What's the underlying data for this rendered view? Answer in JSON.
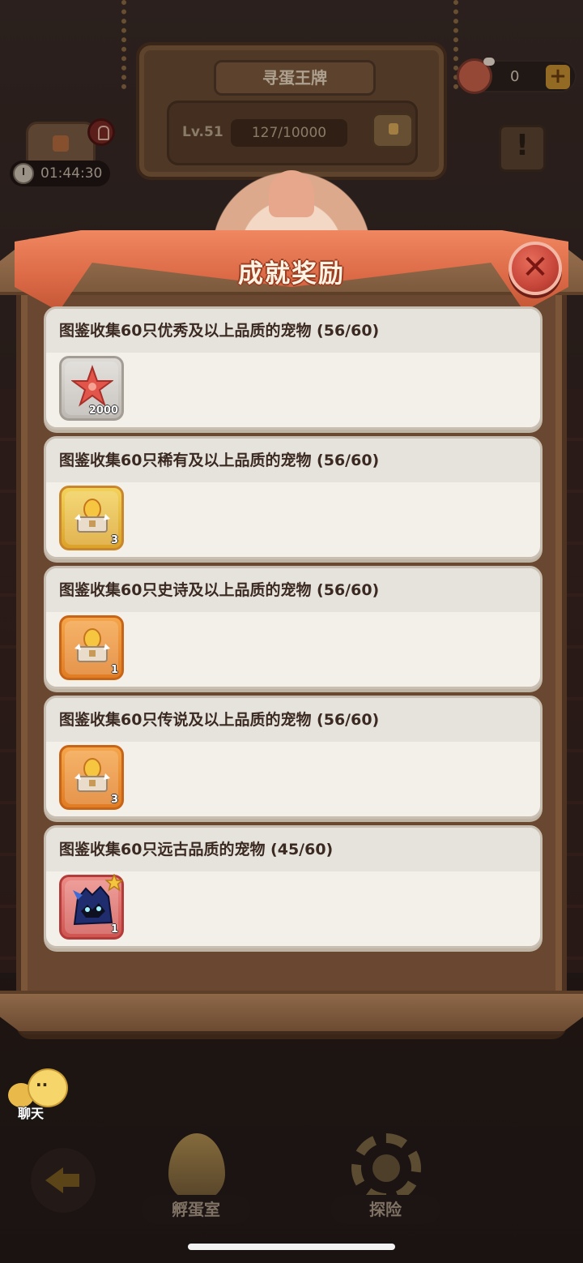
{
  "background": {
    "sign_title": "寻蛋王牌",
    "level_label": "Lv.51",
    "level_progress": "127/10000",
    "meat_count": "0",
    "timer_text": "01:44:30"
  },
  "dialog": {
    "title": "成就奖励",
    "close_symbol": "✕"
  },
  "achievements": [
    {
      "title": "图鉴收集60只优秀及以上品质的宠物 (56/60)",
      "reward": {
        "icon": "starfish-icon",
        "quantity": "2000",
        "frame": "gray"
      }
    },
    {
      "title": "图鉴收集60只稀有及以上品质的宠物 (56/60)",
      "reward": {
        "icon": "egg-chest-icon",
        "quantity": "3",
        "frame": "gold"
      }
    },
    {
      "title": "图鉴收集60只史诗及以上品质的宠物 (56/60)",
      "reward": {
        "icon": "egg-chest-icon",
        "quantity": "1",
        "frame": "orange"
      }
    },
    {
      "title": "图鉴收集60只传说及以上品质的宠物 (56/60)",
      "reward": {
        "icon": "egg-chest-icon",
        "quantity": "3",
        "frame": "orange"
      }
    },
    {
      "title": "图鉴收集60只远古品质的宠物 (45/60)",
      "reward": {
        "icon": "dark-beast-pet-icon",
        "quantity": "1",
        "frame": "red"
      }
    }
  ],
  "bottom_bar": {
    "chat_label": "聊天",
    "hatch_room_label": "孵蛋室",
    "explore_label": "探险"
  },
  "colors": {
    "banner": "#dd6b48",
    "card_bg": "#f3f0ea",
    "frame_wood": "#6a4730",
    "title_text": "#3b2a22"
  }
}
